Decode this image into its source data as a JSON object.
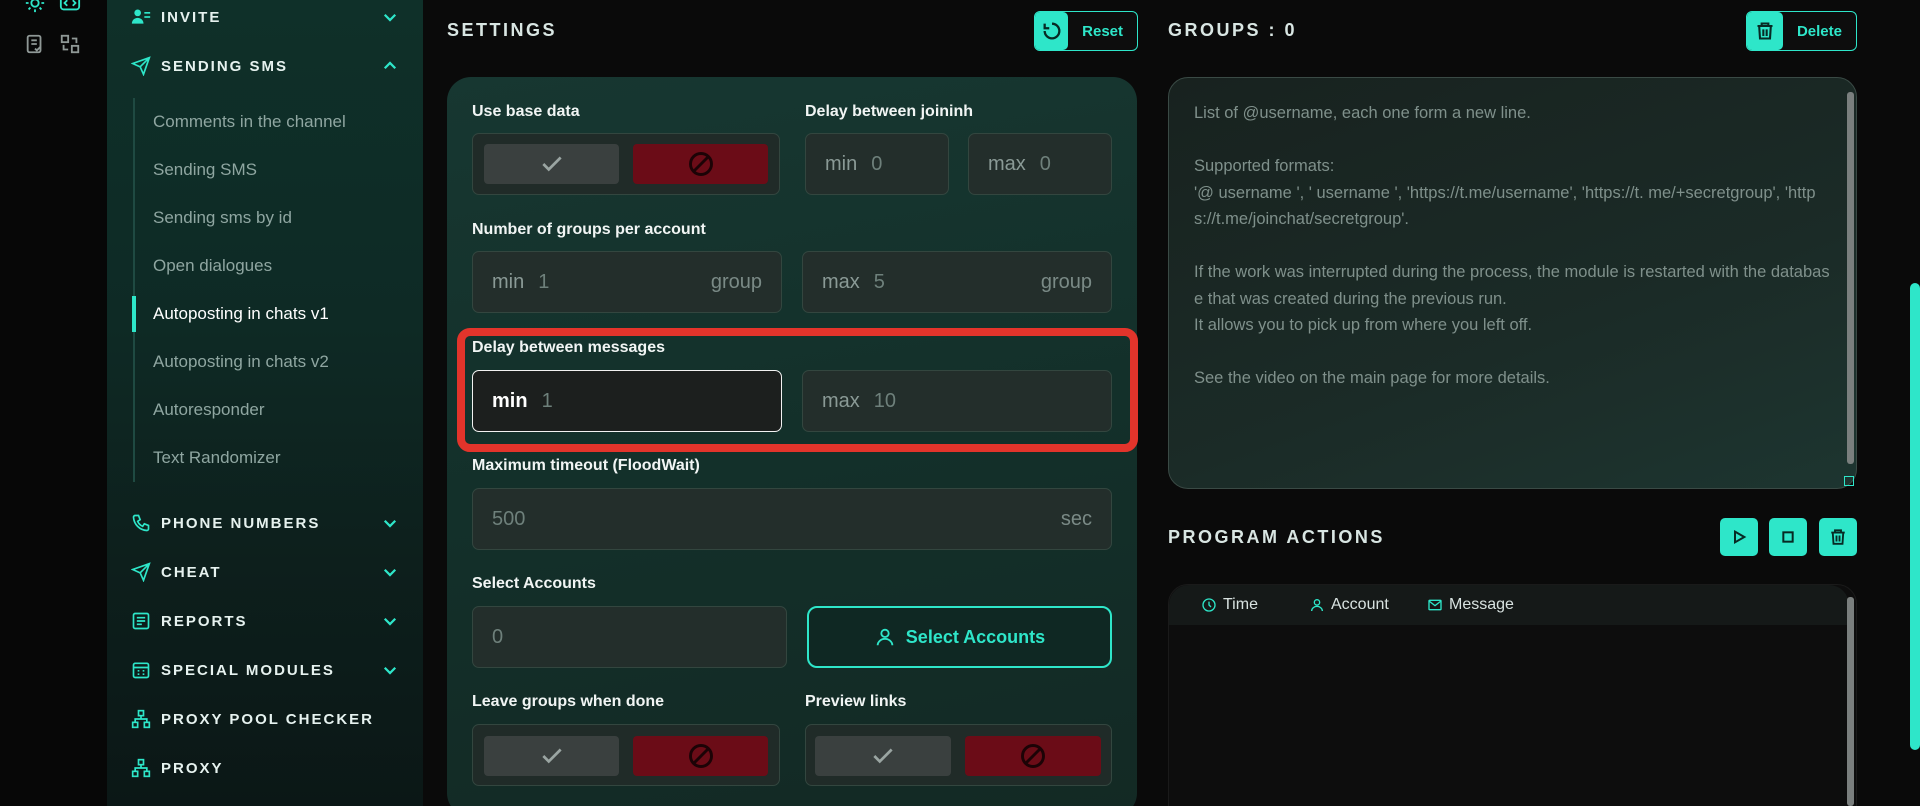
{
  "sidebar": {
    "sections": {
      "invite": "INVITE",
      "sending_sms": "SENDING SMS",
      "phone_numbers": "PHONE NUMBERS",
      "cheat": "CHEAT",
      "reports": "REPORTS",
      "special_modules": "SPECIAL MODULES",
      "proxy_pool_checker": "PROXY POOL CHECKER",
      "proxy": "PROXY"
    },
    "sub_items": [
      {
        "label": "Comments in the channel"
      },
      {
        "label": "Sending SMS"
      },
      {
        "label": "Sending sms by id"
      },
      {
        "label": "Open dialogues"
      },
      {
        "label": "Autoposting in chats v1",
        "active": true
      },
      {
        "label": "Autoposting in chats v2"
      },
      {
        "label": "Autoresponder"
      },
      {
        "label": "Text Randomizer"
      }
    ]
  },
  "settings": {
    "title": "SETTINGS",
    "reset_label": "Reset",
    "use_base_data": "Use base data",
    "delay_joining": {
      "label": "Delay between joininh",
      "min_key": "min",
      "min": "0",
      "max_key": "max",
      "max": "0"
    },
    "groups_per_account": {
      "label": "Number of groups per account",
      "min_key": "min",
      "min": "1",
      "max_key": "max",
      "max": "5",
      "unit": "group"
    },
    "delay_messages": {
      "label": "Delay between messages",
      "min_key": "min",
      "min": "1",
      "max_key": "max",
      "max": "10"
    },
    "max_timeout": {
      "label": "Maximum timeout (FloodWait)",
      "value": "500",
      "unit": "sec"
    },
    "select_accounts": {
      "label": "Select Accounts",
      "value": "0",
      "button": "Select Accounts"
    },
    "leave_groups": "Leave groups when done",
    "preview_links": "Preview links"
  },
  "groups": {
    "title": "GROUPS : 0",
    "delete_label": "Delete",
    "placeholder": "List of @username, each one form a new line.\n\nSupported formats:\n'@ username ', ' username ', 'https://t.me/username', 'https://t. me/+secretgroup', 'https://t.me/joinchat/secretgroup'.\n\nIf the work was interrupted during the process, the module is restarted with the database that was created during the previous run.\nIt allows you to pick up from where you left off.\n\nSee the video on the main page for more details."
  },
  "actions": {
    "title": "PROGRAM ACTIONS",
    "columns": [
      "Time",
      "Account",
      "Message"
    ]
  },
  "colors": {
    "accent": "#2ee6c9",
    "danger": "#6b0c17",
    "highlight": "#e2342b"
  }
}
